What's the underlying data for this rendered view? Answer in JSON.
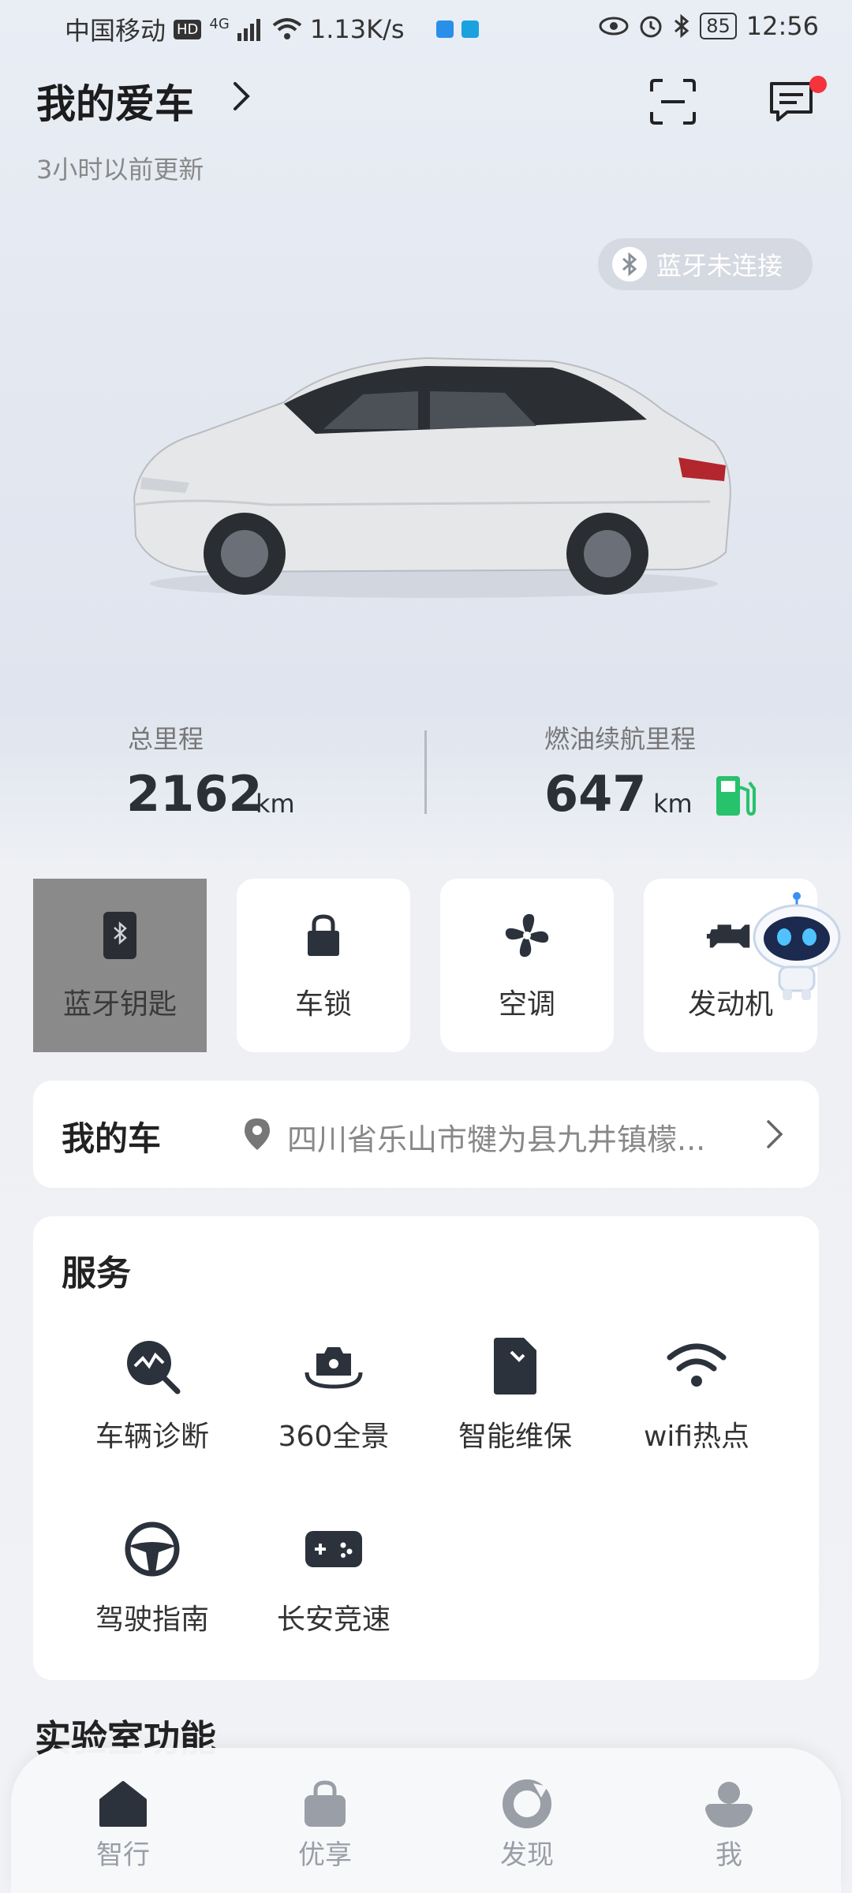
{
  "status_bar": {
    "carrier": "中国移动",
    "hd": "HD",
    "network": "4G",
    "speed": "1.13K/s",
    "battery": "85",
    "time": "12:56"
  },
  "header": {
    "title": "我的爱车",
    "updated": "3小时以前更新",
    "bluetooth_status": "蓝牙未连接"
  },
  "stats": {
    "total_mileage_label": "总里程",
    "total_mileage_value": "2162",
    "total_mileage_unit": "km",
    "fuel_range_label": "燃油续航里程",
    "fuel_range_value": "647",
    "fuel_range_unit": "km"
  },
  "quick_actions": [
    {
      "label": "蓝牙钥匙",
      "icon": "bluetooth-key-icon"
    },
    {
      "label": "车锁",
      "icon": "lock-icon"
    },
    {
      "label": "空调",
      "icon": "fan-icon"
    },
    {
      "label": "发动机",
      "icon": "engine-icon"
    }
  ],
  "my_car": {
    "title": "我的车",
    "address": "四川省乐山市犍为县九井镇檬..."
  },
  "services": {
    "title": "服务",
    "items": [
      {
        "label": "车辆诊断",
        "icon": "diagnosis-icon"
      },
      {
        "label": "360全景",
        "icon": "camera-360-icon"
      },
      {
        "label": "智能维保",
        "icon": "maintenance-icon"
      },
      {
        "label": "wifi热点",
        "icon": "wifi-icon"
      },
      {
        "label": "驾驶指南",
        "icon": "steering-wheel-icon"
      },
      {
        "label": "长安竞速",
        "icon": "gamepad-icon"
      }
    ]
  },
  "lab": {
    "title": "实验室功能"
  },
  "bottom_nav": [
    {
      "label": "智行",
      "icon": "home-icon"
    },
    {
      "label": "优享",
      "icon": "shopping-bag-icon"
    },
    {
      "label": "发现",
      "icon": "discover-icon"
    },
    {
      "label": "我",
      "icon": "profile-icon"
    }
  ],
  "colors": {
    "accent_dark": "#2c323c",
    "fuel_green": "#27c26c",
    "notification_red": "#f4333c"
  }
}
